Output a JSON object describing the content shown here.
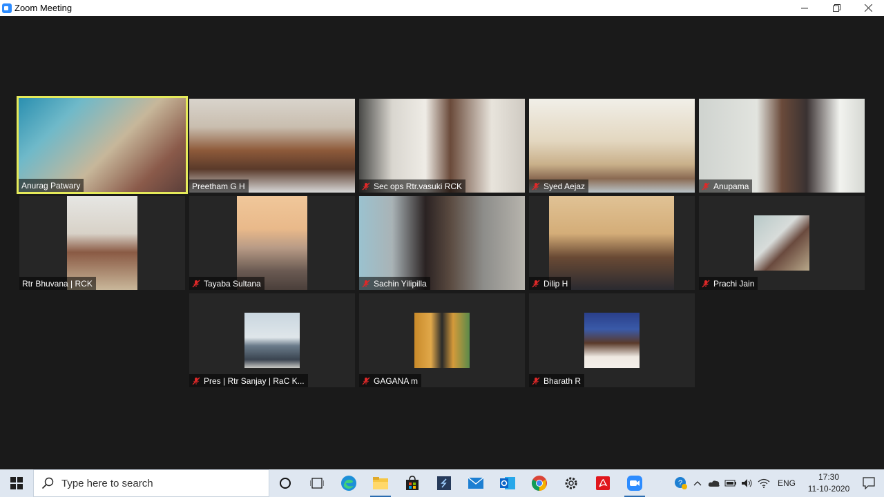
{
  "window": {
    "title": "Zoom Meeting",
    "minimize": "—",
    "restore": "❐",
    "close": "✕"
  },
  "participants": [
    {
      "name": "Anurag Patwary",
      "muted": false,
      "active": true
    },
    {
      "name": "Preetham G H",
      "muted": false,
      "active": false
    },
    {
      "name": "Sec ops Rtr.vasuki RCK",
      "muted": true,
      "active": false
    },
    {
      "name": "Syed Aejaz",
      "muted": true,
      "active": false
    },
    {
      "name": "Anupama",
      "muted": true,
      "active": false
    },
    {
      "name": "Rtr Bhuvana | RCK",
      "muted": false,
      "active": false
    },
    {
      "name": "Tayaba Sultana",
      "muted": true,
      "active": false
    },
    {
      "name": "Sachin Yilipilla",
      "muted": true,
      "active": false
    },
    {
      "name": "Dilip H",
      "muted": true,
      "active": false
    },
    {
      "name": "Prachi Jain",
      "muted": true,
      "active": false
    },
    {
      "name": "Pres | Rtr Sanjay | RaC K...",
      "muted": true,
      "active": false
    },
    {
      "name": "GAGANA m",
      "muted": true,
      "active": false
    },
    {
      "name": "Bharath R",
      "muted": true,
      "active": false
    }
  ],
  "taskbar": {
    "search_placeholder": "Type here to search",
    "language": "ENG",
    "time": "17:30",
    "date": "11-10-2020",
    "apps": [
      "cortana-icon",
      "task-view-icon",
      "edge-icon",
      "file-explorer-icon",
      "store-icon",
      "sticky-app-icon",
      "mail-icon",
      "outlook-icon",
      "chrome-icon",
      "settings-icon",
      "acrobat-icon",
      "zoom-icon"
    ]
  },
  "colors": {
    "active_speaker": "#e5ea5a",
    "muted_mic": "#e02828",
    "background": "#1a1a1a",
    "tile": "#262626"
  }
}
